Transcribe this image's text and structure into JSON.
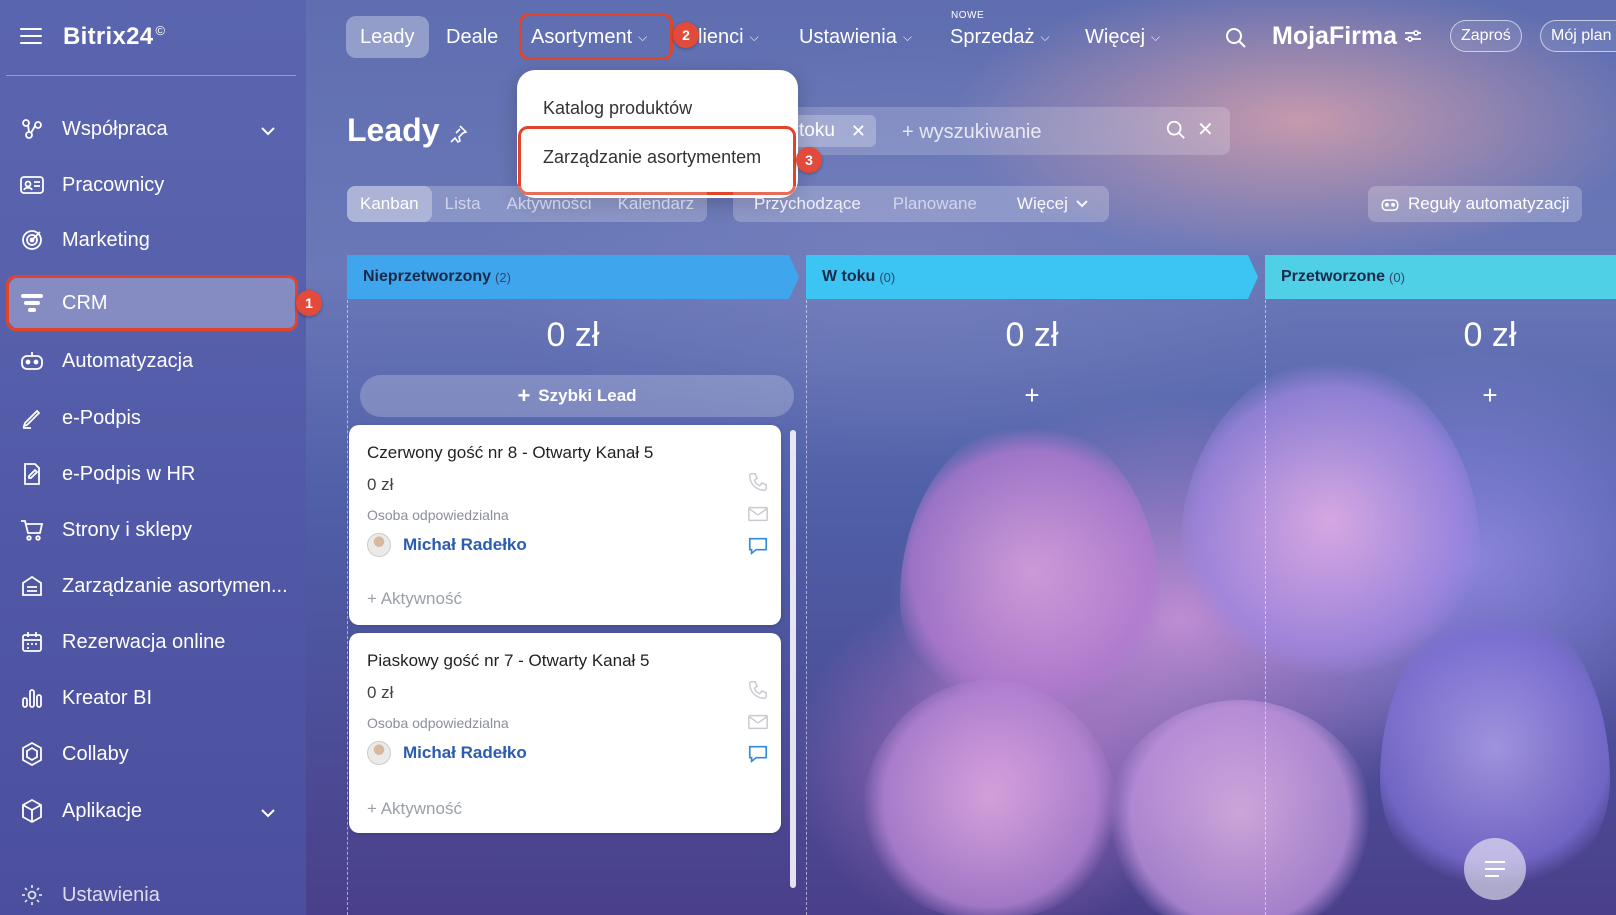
{
  "app": {
    "brand": "Bitrix24",
    "brand_mark": "©"
  },
  "sidebar": {
    "items": [
      {
        "label": "Współpraca",
        "icon": "collaboration-icon",
        "has_chevron": true
      },
      {
        "label": "Pracownicy",
        "icon": "employees-icon"
      },
      {
        "label": "Marketing",
        "icon": "marketing-icon"
      },
      {
        "label": "CRM",
        "icon": "crm-funnel-icon",
        "active": true
      },
      {
        "label": "Automatyzacja",
        "icon": "robot-icon"
      },
      {
        "label": "e-Podpis",
        "icon": "pen-icon"
      },
      {
        "label": "e-Podpis w HR",
        "icon": "document-pen-icon"
      },
      {
        "label": "Strony i sklepy",
        "icon": "cart-icon"
      },
      {
        "label": "Zarządzanie asortymen...",
        "icon": "inventory-icon"
      },
      {
        "label": "Rezerwacja online",
        "icon": "calendar-icon"
      },
      {
        "label": "Kreator BI",
        "icon": "bar-chart-icon"
      },
      {
        "label": "Collaby",
        "icon": "hexagon-icon"
      },
      {
        "label": "Aplikacje",
        "icon": "cube-icon",
        "has_chevron": true
      },
      {
        "label": "Ustawienia",
        "icon": "gear-icon"
      }
    ]
  },
  "topbar": {
    "tabs": [
      {
        "label": "Leady",
        "active": true
      },
      {
        "label": "Deale"
      },
      {
        "label": "Asortyment",
        "caret": true
      },
      {
        "label": "lienci",
        "caret": true
      },
      {
        "label": "Ustawienia",
        "caret": true
      },
      {
        "label": "Sprzedaż",
        "caret": true,
        "tag": "NOWE"
      },
      {
        "label": "Więcej",
        "caret": true
      }
    ],
    "company": "MojaFirma",
    "invite": "Zaproś",
    "my_plan": "Mój plan"
  },
  "dropdown": {
    "items": [
      "Katalog produktów",
      "Zarządzanie asortymentem"
    ]
  },
  "badges": [
    "1",
    "2",
    "3"
  ],
  "page": {
    "title": "Leady",
    "filter_chip": "w toku",
    "search_placeholder": "+ wyszukiwanie"
  },
  "views": {
    "left": [
      "Kanban",
      "Lista",
      "Aktywności",
      "Kalendarz"
    ],
    "right": [
      "Przychodzące",
      "Planowane",
      "Więcej"
    ],
    "automation": "Reguły automatyzacji"
  },
  "columns": [
    {
      "name": "Nieprzetworzony",
      "count": "(2)",
      "sum": "0 zł",
      "color": "#3fa6ee"
    },
    {
      "name": "W toku",
      "count": "(0)",
      "sum": "0 zł",
      "color": "#3cc5f2"
    },
    {
      "name": "Przetworzone",
      "count": "(0)",
      "sum": "0 zł",
      "color": "#4fd0e6"
    }
  ],
  "quick_lead": "Szybki Lead",
  "column_plus": "+",
  "cards": [
    {
      "title": "Czerwony gość nr 8 - Otwarty Kanał 5",
      "amount": "0 zł",
      "responsible_label": "Osoba odpowiedzialna",
      "user": "Michał Radełko",
      "activity": "+ Aktywność"
    },
    {
      "title": "Piaskowy gość nr 7 - Otwarty Kanał 5",
      "amount": "0 zł",
      "responsible_label": "Osoba odpowiedzialna",
      "user": "Michał Radełko",
      "activity": "+ Aktywność"
    }
  ],
  "colors": {
    "highlight": "#e0452b",
    "badge": "#e24b3b",
    "link": "#2a5db0"
  }
}
